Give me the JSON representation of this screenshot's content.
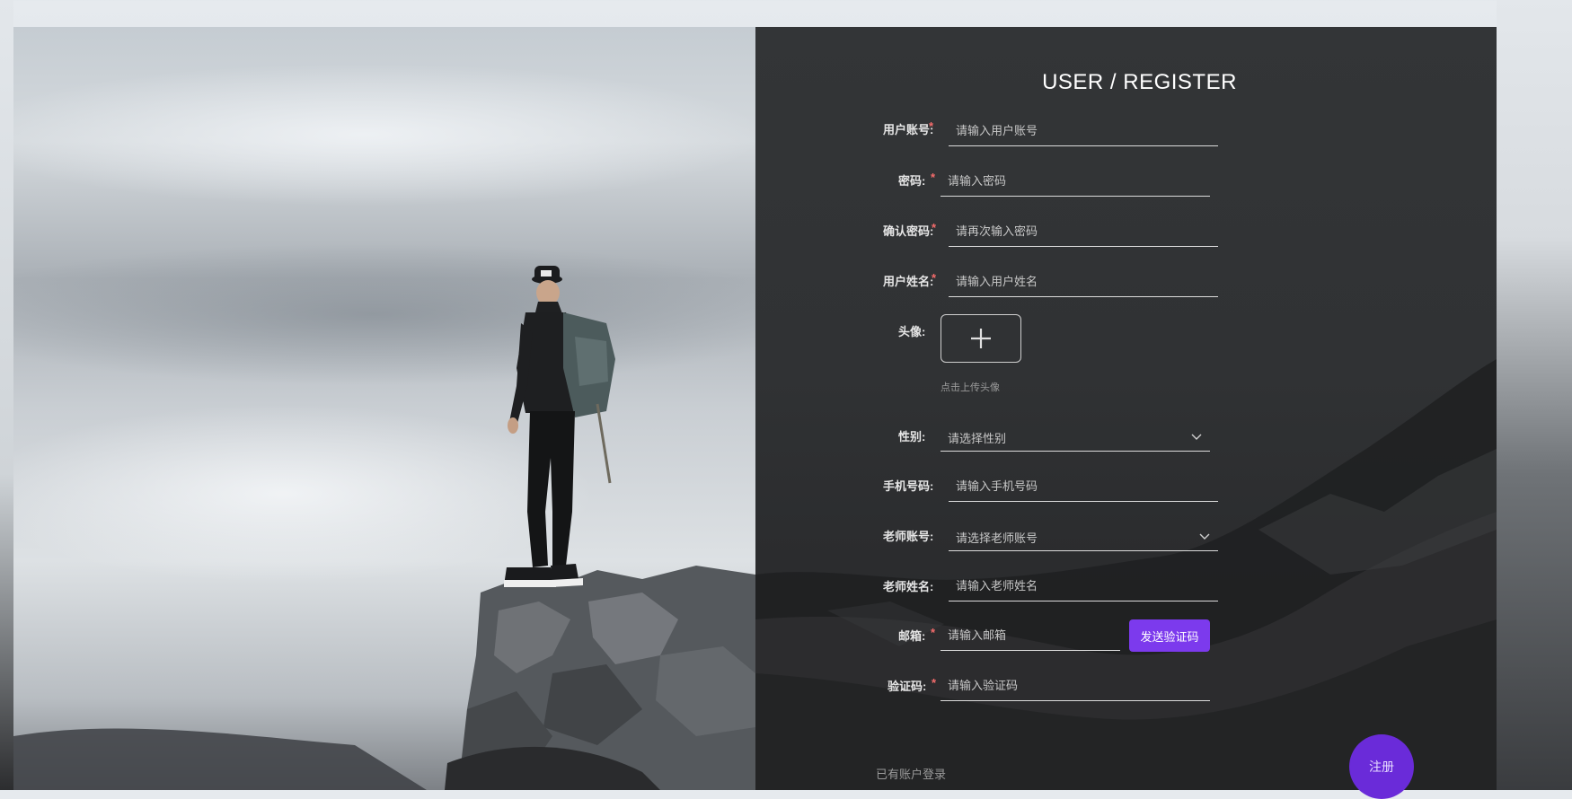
{
  "form": {
    "title": "USER / REGISTER",
    "fields": {
      "account": {
        "label": "用户账号:",
        "required": true,
        "placeholder": "请输入用户账号"
      },
      "password": {
        "label": "密码:",
        "required": true,
        "placeholder": "请输入密码"
      },
      "confirm_password": {
        "label": "确认密码:",
        "required": true,
        "placeholder": "请再次输入密码"
      },
      "name": {
        "label": "用户姓名:",
        "required": true,
        "placeholder": "请输入用户姓名"
      },
      "avatar": {
        "label": "头像:",
        "hint": "点击上传头像"
      },
      "gender": {
        "label": "性别:",
        "placeholder": "请选择性别"
      },
      "phone": {
        "label": "手机号码:",
        "placeholder": "请输入手机号码"
      },
      "teacher_account": {
        "label": "老师账号:",
        "placeholder": "请选择老师账号"
      },
      "teacher_name": {
        "label": "老师姓名:",
        "placeholder": "请输入老师姓名"
      },
      "email": {
        "label": "邮箱:",
        "required": true,
        "placeholder": "请输入邮箱",
        "send_code_label": "发送验证码"
      },
      "code": {
        "label": "验证码:",
        "required": true,
        "placeholder": "请输入验证码"
      }
    },
    "login_link": "已有账户登录",
    "register_label": "注册",
    "required_mark": "*"
  },
  "colors": {
    "accent": "#7c3aed",
    "required": "#f56c6c",
    "panel_bg": "#303234"
  },
  "icons": {
    "upload": "plus-icon",
    "select": "chevron-down-icon"
  }
}
